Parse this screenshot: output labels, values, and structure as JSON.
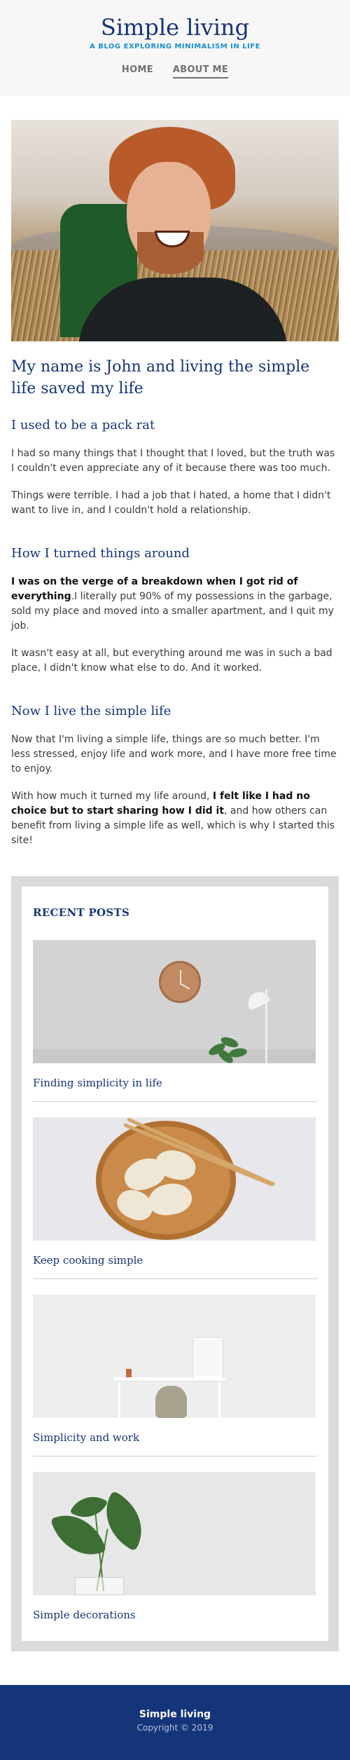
{
  "header": {
    "site_title": "Simple living",
    "subtitle": "A BLOG EXPLORING MINIMALISM IN LIFE",
    "nav": [
      {
        "label": "HOME"
      },
      {
        "label": "ABOUT ME"
      }
    ]
  },
  "article": {
    "title": "My name is John and living the simple life saved my life",
    "sections": [
      {
        "heading": "I used to be a pack rat",
        "paragraphs": [
          "I had so many things that I thought that I loved, but the truth was I couldn't even appreciate any of it because there was too much.",
          "Things were terrible. I had a job that I hated, a home that I didn't want to live in, and I couldn't hold a relationship."
        ]
      },
      {
        "heading": "How I turned things around",
        "p1_bold": "I was on the verge of a breakdown when I got rid of everything",
        "p1_rest": ".I literally put 90% of my possessions in the garbage, sold my place and moved into a smaller apartment, and I quit my job.",
        "p2": "It wasn't easy at all, but everything around me was in such a bad place, I didn't know what else to do. And it worked."
      },
      {
        "heading": "Now I live the simple life",
        "p1": "Now that I'm living a simple life, things are so much better. I'm less stressed, enjoy life and work more, and I have more free time to enjoy.",
        "p2_start": "With how much it turned my life around, ",
        "p2_bold": "I felt like I had no choice but to start sharing how I did it",
        "p2_end": ", and how others can benefit from living a simple life as well, which is why I started this site!"
      }
    ]
  },
  "recent_posts": {
    "title": "RECENT POSTS",
    "posts": [
      {
        "title": "Finding simplicity in life",
        "image": "wall-clock-lamp-plant"
      },
      {
        "title": "Keep cooking simple",
        "image": "dumplings-on-wooden-plate"
      },
      {
        "title": "Simplicity and work",
        "image": "minimal-desk-and-chair"
      },
      {
        "title": "Simple decorations",
        "image": "plant-in-glass-vase"
      }
    ]
  },
  "footer": {
    "title": "Simple living",
    "copyright": "Copyright © 2019"
  },
  "colors": {
    "brand_blue": "#16347a",
    "accent_blue": "#1b8fd6",
    "footer_bg": "#14357a",
    "header_bg": "#f7f7f7"
  }
}
